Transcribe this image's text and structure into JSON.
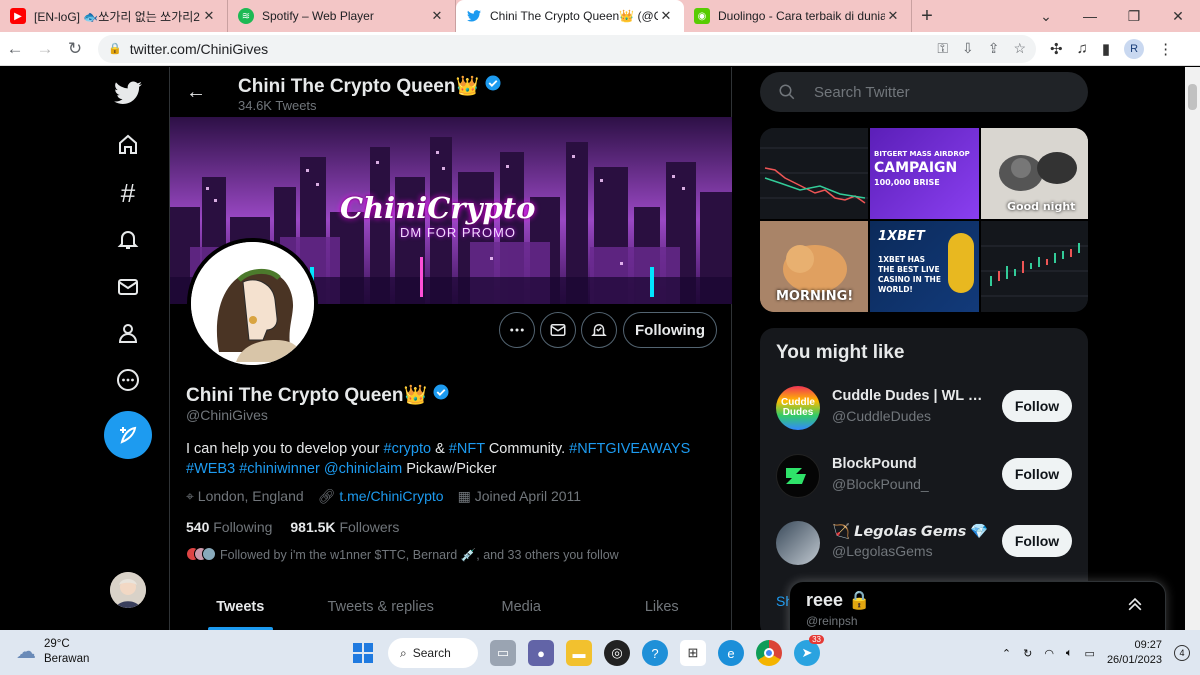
{
  "browser": {
    "tabs": [
      {
        "title": "[EN-loG] 🐟쏘가리 없는 쏘가리2",
        "favicon": "youtube-icon",
        "color": "#ff0000"
      },
      {
        "title": "Spotify – Web Player",
        "favicon": "spotify-icon",
        "color": "#1db954"
      },
      {
        "title": "Chini The Crypto Queen👑 (@Ch",
        "favicon": "twitter-icon",
        "color": "#1d9bf0"
      },
      {
        "title": "Duolingo - Cara terbaik di dunia",
        "favicon": "duolingo-icon",
        "color": "#58cc02"
      }
    ],
    "url": "twitter.com/ChiniGives",
    "profile_initial": "R"
  },
  "header": {
    "name": "Chini The Crypto Queen👑",
    "tweet_count": "34.6K Tweets"
  },
  "banner": {
    "title": "ChiniCrypto",
    "subtitle": "DM FOR PROMO",
    "avatar_text": "Chini the Crypto Queen"
  },
  "profile": {
    "name": "Chini The Crypto Queen👑",
    "handle": "@ChiniGives",
    "following_button": "Following",
    "bio_parts": [
      "I can help you to develop your ",
      "#crypto",
      " & ",
      "#NFT",
      " Community. ",
      "#NFTGIVEAWAYS",
      "#WEB3",
      " ",
      "#chiniwinner",
      " ",
      "@chiniclaim",
      " Pickaw/Picker"
    ],
    "location": "London, England",
    "link": "t.me/ChiniCrypto",
    "joined": "Joined April 2011",
    "following_count": "540",
    "following_label": "Following",
    "followers_count": "981.5K",
    "followers_label": "Followers",
    "followed_by": "Followed by i'm the w1nner $TTC, Bernard 💉, and 33 others you follow"
  },
  "profile_tabs": [
    "Tweets",
    "Tweets & replies",
    "Media",
    "Likes"
  ],
  "search": {
    "placeholder": "Search Twitter"
  },
  "media_labels": {
    "campaign_top": "BITGERT MASS AIRDROP",
    "campaign": "CAMPAIGN",
    "campaign_sub": "100,000 BRISE",
    "goodnight": "Good night",
    "morning": "MORNING!",
    "bet_logo": "1XBET",
    "bet_text": "1XBET HAS THE BEST LIVE CASINO IN THE WORLD!"
  },
  "who_to_follow": {
    "title": "You might like",
    "follow_label": "Follow",
    "show_more": "Show more",
    "items": [
      {
        "name": "Cuddle Dudes | WL Mi...",
        "handle": "@CuddleDudes"
      },
      {
        "name": "BlockPound",
        "handle": "@BlockPound_"
      },
      {
        "name": "🏹 𝙇𝙚𝙜𝙤𝙡𝙖𝙨 𝙂𝙚𝙢𝙨 💎",
        "handle": "@LegolasGems"
      }
    ]
  },
  "dm_drawer": {
    "name": "reee 🔒",
    "handle": "@reinpsh"
  },
  "taskbar": {
    "temp": "29°C",
    "weather": "Berawan",
    "search_label": "Search",
    "time": "09:27",
    "date": "26/01/2023",
    "notif_count": "4",
    "telegram_badge": "33"
  },
  "colors": {
    "accent": "#1d9bf0",
    "bg": "#000000",
    "tabbar": "#f3c6c6"
  }
}
